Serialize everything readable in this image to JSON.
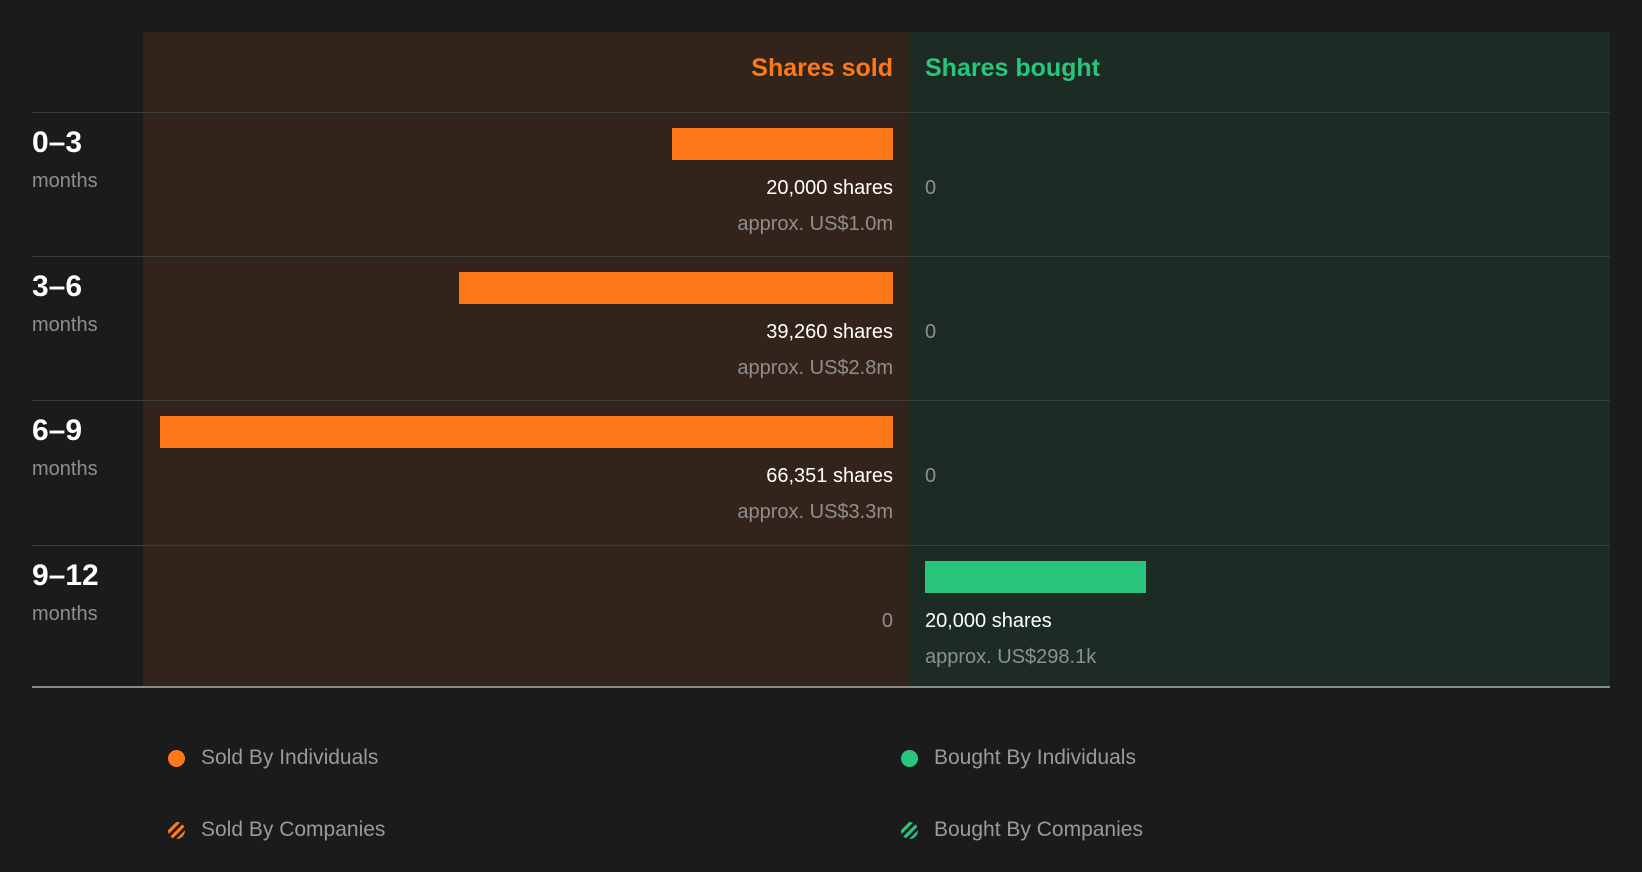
{
  "colors": {
    "sold": "#fd7918",
    "bought": "#2ac57d",
    "sold_panel": "#33241b",
    "bought_panel": "#1d2b25"
  },
  "header": {
    "sold_label": "Shares sold",
    "bought_label": "Shares bought"
  },
  "chart_data": {
    "type": "bar",
    "orientation": "horizontal-diverging",
    "categories": [
      "0-3 months",
      "3-6 months",
      "6-9 months",
      "9-12 months"
    ],
    "series": [
      {
        "name": "Shares sold",
        "values": [
          20000,
          39260,
          66351,
          0
        ]
      },
      {
        "name": "Shares bought",
        "values": [
          0,
          0,
          0,
          20000
        ]
      }
    ],
    "sold_max": 66351,
    "bought_max": 66351
  },
  "rows": [
    {
      "period": "0–3",
      "unit": "months",
      "sold_shares": "20,000 shares",
      "sold_approx": "approx. US$1.0m",
      "sold_value": 20000,
      "bought_shares": "0",
      "bought_approx": "",
      "bought_value": 0
    },
    {
      "period": "3–6",
      "unit": "months",
      "sold_shares": "39,260 shares",
      "sold_approx": "approx. US$2.8m",
      "sold_value": 39260,
      "bought_shares": "0",
      "bought_approx": "",
      "bought_value": 0
    },
    {
      "period": "6–9",
      "unit": "months",
      "sold_shares": "66,351 shares",
      "sold_approx": "approx. US$3.3m",
      "sold_value": 66351,
      "bought_shares": "0",
      "bought_approx": "",
      "bought_value": 0
    },
    {
      "period": "9–12",
      "unit": "months",
      "sold_shares": "0",
      "sold_approx": "",
      "sold_value": 0,
      "bought_shares": "20,000 shares",
      "bought_approx": "approx. US$298.1k",
      "bought_value": 20000
    }
  ],
  "legend": {
    "sold_individuals": "Sold By Individuals",
    "sold_companies": "Sold By Companies",
    "bought_individuals": "Bought By Individuals",
    "bought_companies": "Bought By Companies"
  }
}
